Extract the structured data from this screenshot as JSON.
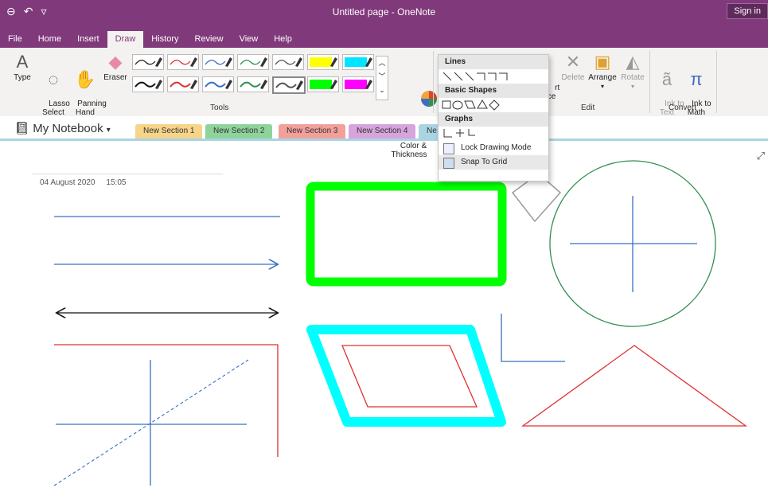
{
  "window": {
    "title": "Untitled page - OneNote",
    "sign_in": "Sign in"
  },
  "menu": [
    {
      "label": "File",
      "active": false
    },
    {
      "label": "Home",
      "active": false
    },
    {
      "label": "Insert",
      "active": false
    },
    {
      "label": "Draw",
      "active": true
    },
    {
      "label": "History",
      "active": false
    },
    {
      "label": "Review",
      "active": false
    },
    {
      "label": "View",
      "active": false
    },
    {
      "label": "Help",
      "active": false
    }
  ],
  "ribbon": {
    "type": "Type",
    "lasso": "Lasso\nSelect",
    "panning": "Panning\nHand",
    "eraser": "Eraser",
    "color_thickness": "Color &\nThickness",
    "tools_group": "Tools",
    "insert_space": "rt\nce",
    "delete": "Delete",
    "arrange": "Arrange",
    "rotate": "Rotate",
    "edit_group": "Edit",
    "ink_to_text": "Ink to\nText",
    "ink_to_math": "Ink to\nMath",
    "convert_group": "Convert",
    "pens": [
      {
        "color": "#222222"
      },
      {
        "color": "#e03030"
      },
      {
        "color": "#3a6fc4"
      },
      {
        "color": "#2f8f4f"
      },
      {
        "color": "#555555"
      },
      {
        "color": "#ffff00"
      },
      {
        "color": "#00e5ff"
      },
      {
        "color": "#111111"
      },
      {
        "color": "#e03030"
      },
      {
        "color": "#3a6fc4"
      },
      {
        "color": "#2f8f4f"
      },
      {
        "color": "#555555"
      },
      {
        "color": "#00ff00"
      },
      {
        "color": "#ff00ff"
      }
    ]
  },
  "notebook": {
    "name": "My Notebook",
    "tabs": [
      {
        "label": "New Section 1",
        "color": "#f6d48a"
      },
      {
        "label": "New Section 2",
        "color": "#8dd39a"
      },
      {
        "label": "New Section 3",
        "color": "#f3a09a"
      },
      {
        "label": "New Section 4",
        "color": "#d7a4dc"
      },
      {
        "label": "Ne",
        "color": "#a9d5e2"
      }
    ]
  },
  "page": {
    "date": "04 August 2020",
    "time": "15:05"
  },
  "shapes_menu": {
    "lines_header": "Lines",
    "basic_shapes_header": "Basic Shapes",
    "graphs_header": "Graphs",
    "lock_drawing": "Lock Drawing Mode",
    "snap_to_grid": "Snap To Grid"
  },
  "colors": {
    "accent": "#80397b",
    "green": "#00ff00",
    "cyan": "#00ffff",
    "blue": "#3a6fc4",
    "red": "#e03030"
  }
}
